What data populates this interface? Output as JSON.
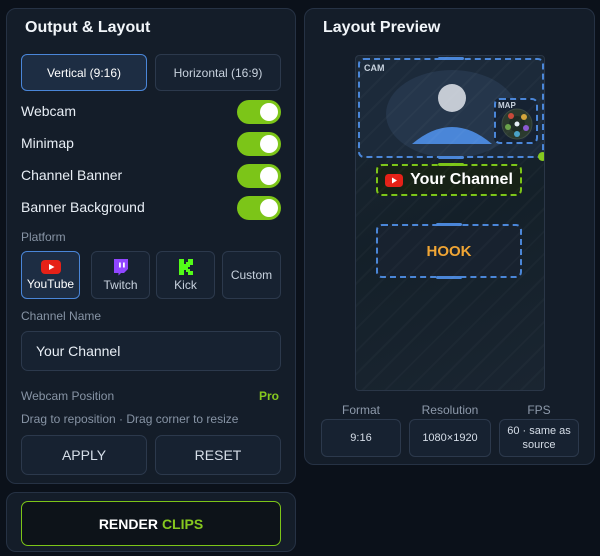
{
  "output_layout": {
    "title": "Output & Layout",
    "orientation": {
      "options": [
        "Vertical (9:16)",
        "Horizontal (16:9)"
      ],
      "selected": "Vertical (9:16)"
    },
    "toggles": [
      {
        "label": "Webcam",
        "on": true
      },
      {
        "label": "Minimap",
        "on": true
      },
      {
        "label": "Channel Banner",
        "on": true
      },
      {
        "label": "Banner Background",
        "on": true
      }
    ],
    "platform": {
      "label": "Platform",
      "options": [
        "YouTube",
        "Twitch",
        "Kick",
        "Custom"
      ],
      "selected": "YouTube",
      "icons": [
        "youtube-icon",
        "twitch-icon",
        "kick-icon"
      ]
    },
    "channel_name": {
      "label": "Channel Name",
      "value": "Your Channel"
    },
    "webcam_position": {
      "label": "Webcam Position",
      "badge": "Pro",
      "hint": "Drag to reposition  ·  Drag corner to resize"
    },
    "apply_label": "APPLY",
    "reset_label": "RESET"
  },
  "render": {
    "label_part1": "RENDER",
    "label_part2": "CLIPS"
  },
  "layout_preview": {
    "title": "Layout Preview",
    "cam_label": "CAM",
    "map_label": "MAP",
    "banner_text": "Your Channel",
    "hook_text": "HOOK",
    "stats": [
      {
        "label": "Format",
        "value": "9:16"
      },
      {
        "label": "Resolution",
        "value": "1080×1920"
      },
      {
        "label": "FPS",
        "value": "60 · same as source"
      }
    ]
  },
  "colors": {
    "accent_green": "#7cc518",
    "accent_blue": "#4a86d8",
    "hook_orange": "#f0a534",
    "youtube_red": "#e62117",
    "twitch_purple": "#9146ff",
    "kick_green": "#53fc18"
  }
}
